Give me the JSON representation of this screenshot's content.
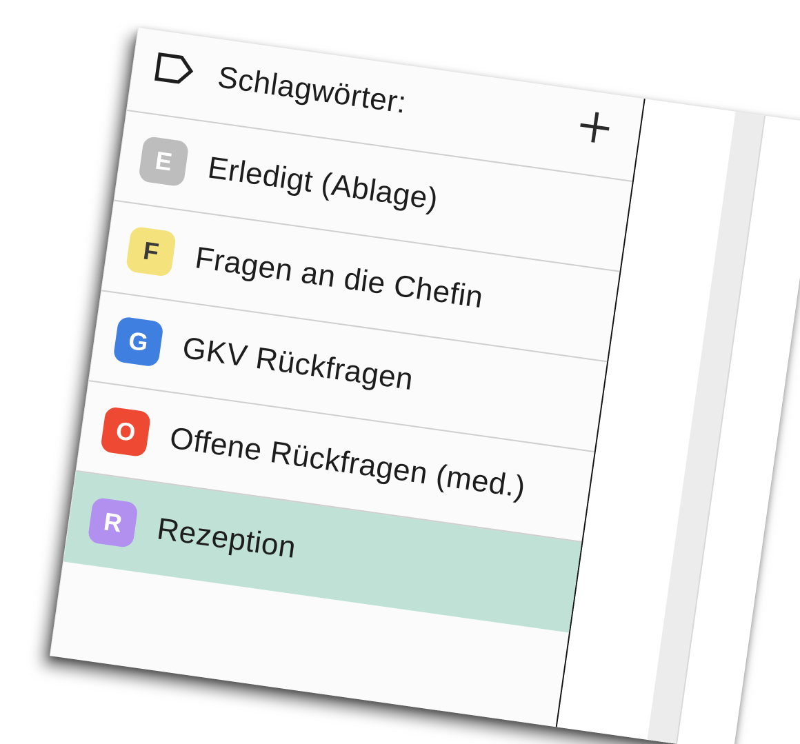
{
  "header": {
    "title": "Schlagwörter:",
    "tag_icon": "tag-icon",
    "add_icon": "plus-icon"
  },
  "tags": [
    {
      "letter": "E",
      "label": "Erledigt (Ablage)",
      "color": "#bdbdbd",
      "text_color": "#ffffff"
    },
    {
      "letter": "F",
      "label": "Fragen an die Chefin",
      "color": "#f4e27d",
      "text_color": "#3a3a3a"
    },
    {
      "letter": "G",
      "label": "GKV Rückfragen",
      "color": "#3f7fe0",
      "text_color": "#ffffff"
    },
    {
      "letter": "O",
      "label": "Offene Rückfragen (med.)",
      "color": "#ee4a33",
      "text_color": "#ffffff"
    },
    {
      "letter": "R",
      "label": "Rezeption",
      "color": "#b190f0",
      "text_color": "#ffffff",
      "selected": true
    }
  ],
  "colors": {
    "selected_row": "#c0e1d5",
    "sidebar_bg": "#fbfbfb",
    "divider": "#cfcfcf"
  }
}
